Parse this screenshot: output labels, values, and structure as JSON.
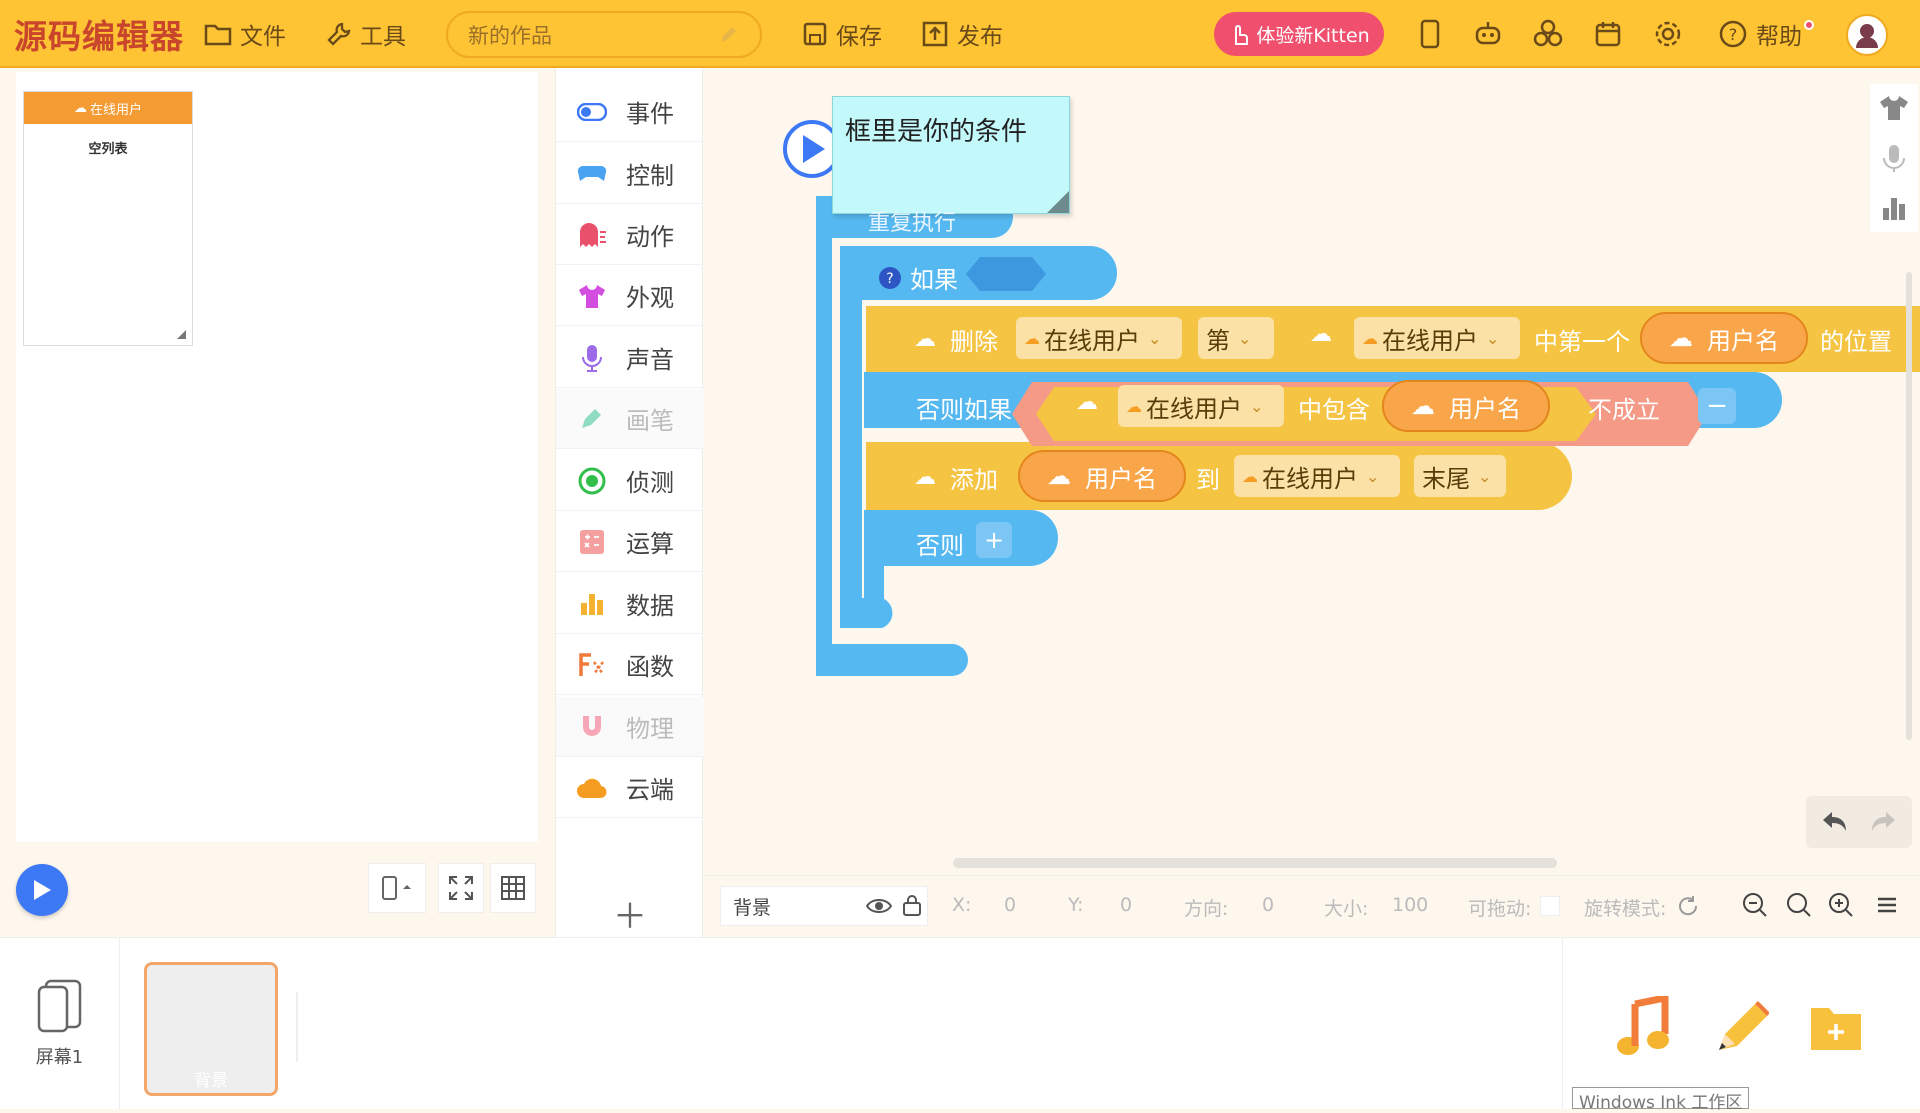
{
  "topbar": {
    "logo": "源码编辑器",
    "file_menu": "文件",
    "tools_menu": "工具",
    "project_title": "新的作品",
    "save_label": "保存",
    "publish_label": "发布",
    "kitten_button": "体验新Kitten",
    "help_label": "帮助"
  },
  "stage": {
    "list_widget_title": "在线用户",
    "list_widget_empty": "空列表"
  },
  "categories": [
    {
      "label": "事件",
      "icon": "toggle-icon",
      "color": "#3e79f5"
    },
    {
      "label": "控制",
      "icon": "gamepad-icon",
      "color": "#4aa3f0"
    },
    {
      "label": "动作",
      "icon": "ghost-icon",
      "color": "#e9506b"
    },
    {
      "label": "外观",
      "icon": "tshirt-icon",
      "color": "#d24de0"
    },
    {
      "label": "声音",
      "icon": "microphone-icon",
      "color": "#9b6be8"
    },
    {
      "label": "画笔",
      "icon": "pen-icon",
      "color": "#7fd4b8"
    },
    {
      "label": "侦测",
      "icon": "radar-icon",
      "color": "#2fbf4a"
    },
    {
      "label": "运算",
      "icon": "calculator-icon",
      "color": "#f28a8a"
    },
    {
      "label": "数据",
      "icon": "bar-chart-icon",
      "color": "#f5b22e"
    },
    {
      "label": "函数",
      "icon": "function-icon",
      "color": "#f07a3a"
    },
    {
      "label": "物理",
      "icon": "magnet-icon",
      "color": "#f28aa0"
    },
    {
      "label": "云端",
      "icon": "cloud-icon",
      "color": "#f59d20"
    }
  ],
  "workspace": {
    "comment": "框里是你的条件",
    "repeat_label": "重复执行",
    "if_label": "如果",
    "delete_label": "删除",
    "list_dropdown": "在线用户",
    "nth_dropdown": "第",
    "first_index_label": "中第一个",
    "username_label": "用户名",
    "position_label": "的位置",
    "else_if_label": "否则如果",
    "contains_label": "中包含",
    "not_true_label": "不成立",
    "add_label": "添加",
    "to_label": "到",
    "end_dropdown": "末尾",
    "else_label": "否则"
  },
  "propbar": {
    "sprite_name": "背景",
    "x_label": "X:",
    "x_value": "0",
    "y_label": "Y:",
    "y_value": "0",
    "dir_label": "方向:",
    "dir_value": "0",
    "size_label": "大小:",
    "size_value": "100",
    "drag_label": "可拖动:",
    "rotate_label": "旋转模式:"
  },
  "bottom": {
    "screen_label": "屏幕1",
    "background_label": "背景",
    "ink_tooltip": "Windows Ink 工作区"
  },
  "colors": {
    "topbar": "#fec433",
    "control_block": "#56b8f0",
    "data_block": "#f5c443",
    "cloud_var": "#f9a64a",
    "operator_block": "#f59a86",
    "kitten_button": "#f04f6e"
  }
}
